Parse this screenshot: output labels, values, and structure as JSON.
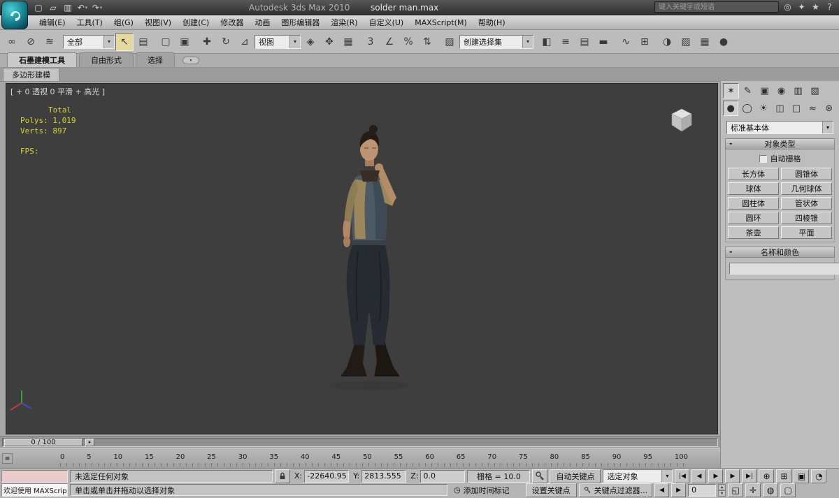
{
  "title_bar": {
    "app_title": "Autodesk 3ds Max  2010",
    "file_name": "solder man.max",
    "search_placeholder": "键入关键字或短语"
  },
  "menu_bar": {
    "items": [
      "编辑(E)",
      "工具(T)",
      "组(G)",
      "视图(V)",
      "创建(C)",
      "修改器",
      "动画",
      "图形编辑器",
      "渲染(R)",
      "自定义(U)",
      "MAXScript(M)",
      "帮助(H)"
    ]
  },
  "toolbar": {
    "selection_filter_value": "全部",
    "ref_coord_value": "视图",
    "named_sets_value": "创建选择集"
  },
  "ribbon": {
    "tabs": [
      {
        "label": "石墨建模工具"
      },
      {
        "label": "自由形式"
      },
      {
        "label": "选择"
      }
    ],
    "subtab": "多边形建模"
  },
  "viewport": {
    "label": "[ + 0 透视 0 平滑 + 高光 ]",
    "stats": {
      "total": "Total",
      "polys": "Polys: 1,019",
      "verts": "Verts: 897",
      "fps": "FPS:"
    }
  },
  "command_panel": {
    "category_dropdown_value": "标准基本体",
    "object_type": {
      "title": "对象类型",
      "autogrid_label": "自动栅格",
      "buttons": [
        "长方体",
        "圆锥体",
        "球体",
        "几何球体",
        "圆柱体",
        "管状体",
        "圆环",
        "四棱锥",
        "茶壶",
        "平面"
      ]
    },
    "name_color": {
      "title": "名称和颜色"
    }
  },
  "timeline": {
    "slider_label": "0 / 100",
    "ticks": [
      "0",
      "5",
      "10",
      "15",
      "20",
      "25",
      "30",
      "35",
      "40",
      "45",
      "50",
      "55",
      "60",
      "65",
      "70",
      "75",
      "80",
      "85",
      "90",
      "95",
      "100"
    ]
  },
  "status_bar": {
    "listener_text": "欢迎使用 MAXScript",
    "status_text": "未选定任何对象",
    "prompt_text": "单击或单击并拖动以选择对象",
    "add_time_tag": "添加时间标记",
    "x_label": "X:",
    "x_value": "-22640.95",
    "y_label": "Y:",
    "y_value": "2813.555",
    "z_label": "Z:",
    "z_value": "0.0",
    "grid_text": "栅格 = 10.0",
    "auto_key_label": "自动关键点",
    "set_key_label": "设置关键点",
    "selection_mode_value": "选定对象",
    "key_filters_label": "关键点过滤器...",
    "frame_value": "0"
  },
  "colors": {
    "viewport_bg": "#3e3e3e",
    "object_swatch": "#8a1028"
  },
  "icons": {
    "new_scene": "▢",
    "open_file": "▱",
    "save_file": "▥",
    "undo": "↶",
    "redo": "↷",
    "dropdown": "▾",
    "search": "◎",
    "comm": "✦",
    "favorites": "★",
    "help": "?",
    "link": "∞",
    "unlink": "⊘",
    "bind_spacewarp": "≋",
    "select": "↖",
    "select_by_name": "▤",
    "rect_region": "▢",
    "window_crossing": "▣",
    "move": "✚",
    "rotate": "↻",
    "scale": "⊿",
    "use_center": "◈",
    "manipulate": "✥",
    "kbd_override": "▦",
    "snap3": "3",
    "snap_angle": "∠",
    "snap_percent": "%",
    "snap_spinner": "⇅",
    "named_sel": "▧",
    "mirror": "◧",
    "align": "≡",
    "layers": "▤",
    "toggle_ribbon": "▬",
    "curve_editor": "∿",
    "schematic": "⊞",
    "material": "◑",
    "render_setup": "▨",
    "rendered_frame": "▦",
    "render": "●",
    "tab_create": "✶",
    "tab_modify": "✎",
    "tab_hierarchy": "▣",
    "tab_motion": "◉",
    "tab_display": "▥",
    "tab_utilities": "▧",
    "cat_geometry": "●",
    "cat_shapes": "◯",
    "cat_lights": "☀",
    "cat_cameras": "◫",
    "cat_helpers": "□",
    "cat_spacewarps": "≈",
    "cat_systems": "⊛",
    "rollout_minus": "-",
    "slider_next": "▸",
    "trackbar_menu": "≡",
    "time_tag": "◷",
    "go_start": "|◀",
    "prev_frame": "◀",
    "play": "▶",
    "next_frame": "▶",
    "go_end": "▶|",
    "prev_key": "◀",
    "next_key": "▶",
    "spin_up": "▴",
    "spin_down": "▾",
    "nav_zoom": "⊕",
    "nav_zoom_all": "⊞",
    "nav_extents": "▣",
    "nav_fov": "◔",
    "nav_region": "◱",
    "nav_pan": "✛",
    "nav_orbit": "◍",
    "nav_max": "▢"
  }
}
